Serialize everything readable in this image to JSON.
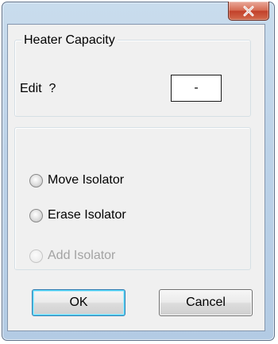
{
  "window": {
    "close_icon": "close-icon"
  },
  "heater_group": {
    "legend": "Heater Capacity",
    "edit_label": "Edit  ?",
    "edit_value": "-"
  },
  "isolator_group": {
    "options": [
      {
        "label": "Move Isolator",
        "enabled": true,
        "selected": false
      },
      {
        "label": "Erase Isolator",
        "enabled": true,
        "selected": false
      },
      {
        "label": "Add Isolator",
        "enabled": false,
        "selected": false
      }
    ]
  },
  "buttons": {
    "ok_label": "OK",
    "cancel_label": "Cancel"
  },
  "colors": {
    "close_button": "#c2402a",
    "frame": "#bcd2e8",
    "client": "#f0f0f0",
    "default_button_border": "#3c7fb1"
  }
}
